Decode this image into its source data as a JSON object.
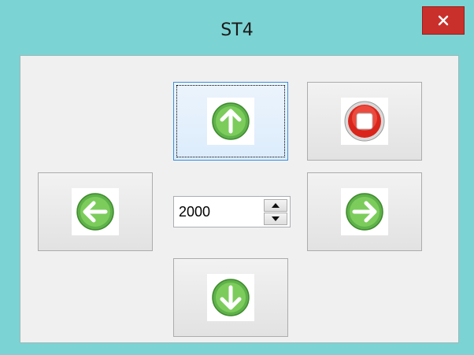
{
  "window": {
    "title": "ST4",
    "accent_color": "#7cd3d3",
    "close_color": "#c9302c"
  },
  "buttons": {
    "up": {
      "icon": "arrow-up-icon"
    },
    "stop": {
      "icon": "stop-icon"
    },
    "left": {
      "icon": "arrow-left-icon"
    },
    "right": {
      "icon": "arrow-right-icon"
    },
    "down": {
      "icon": "arrow-down-icon"
    }
  },
  "spinner": {
    "value": "2000"
  }
}
